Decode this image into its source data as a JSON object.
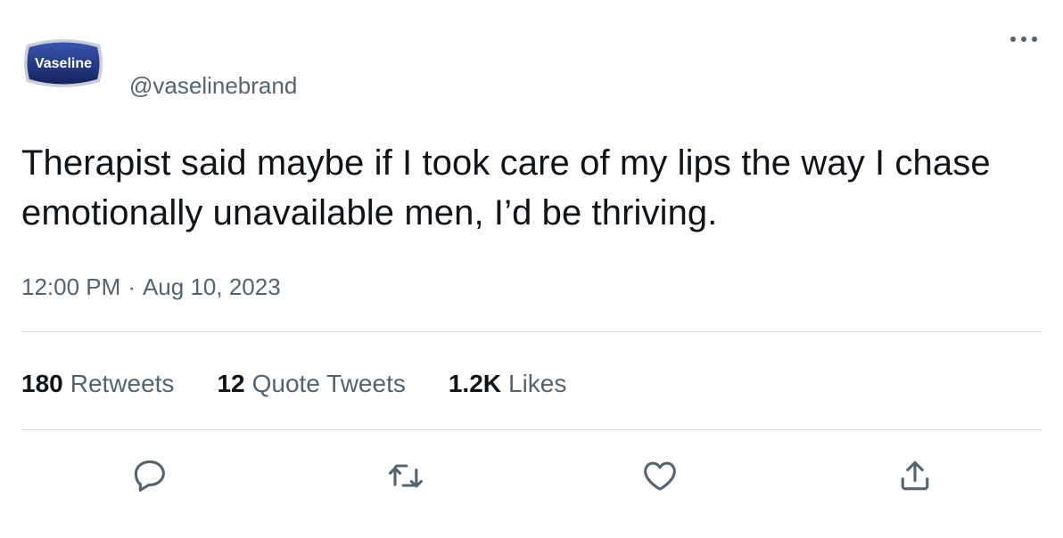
{
  "author": {
    "avatar_text": "Vaseline",
    "handle": "@vaselinebrand"
  },
  "tweet": {
    "text": "Therapist said maybe if I took care of my lips the way I chase emotionally unavailable men, I’d be thriving.",
    "time": "12:00 PM",
    "separator": "·",
    "date": "Aug 10, 2023"
  },
  "stats": {
    "retweets": {
      "count": "180",
      "label": "Retweets"
    },
    "quotes": {
      "count": "12",
      "label": "Quote Tweets"
    },
    "likes": {
      "count": "1.2K",
      "label": "Likes"
    }
  },
  "icons": {
    "more": "more-icon",
    "reply": "reply-icon",
    "retweet": "retweet-icon",
    "like": "like-icon",
    "share": "share-icon"
  },
  "colors": {
    "text_primary": "#0f1419",
    "text_secondary": "#536471",
    "divider": "#cfd9de",
    "brand_navy": "#1c2f7a"
  }
}
